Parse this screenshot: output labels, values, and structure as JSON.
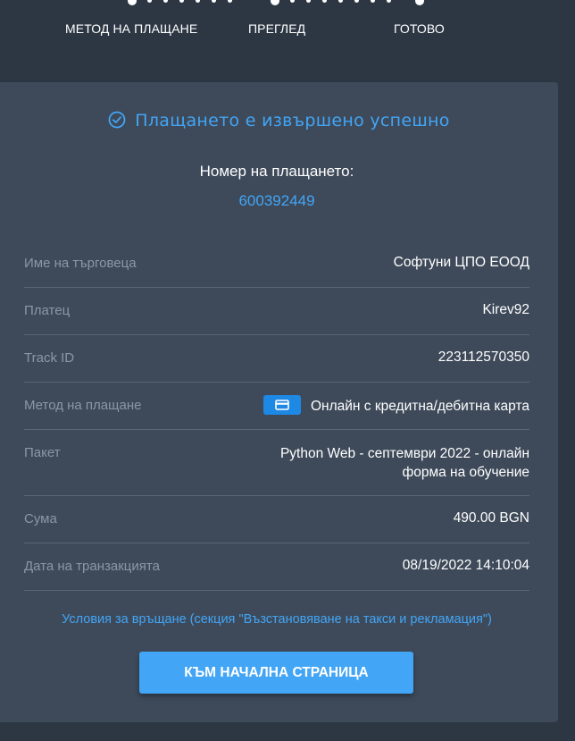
{
  "steps": [
    {
      "label": "МЕТОД НА ПЛАЩАНЕ"
    },
    {
      "label": "ПРЕГЛЕД"
    },
    {
      "label": "ГОТОВО"
    }
  ],
  "success": {
    "message": "Плащането е извършено успешно",
    "icon": "check-circle-icon",
    "color": "#42a5f5"
  },
  "payment": {
    "number_label": "Номер на плащането:",
    "number": "600392449"
  },
  "details": [
    {
      "label": "Име на търговеца",
      "value": "Софтуни ЦПО ЕООД"
    },
    {
      "label": "Платец",
      "value": "Kirev92"
    },
    {
      "label": "Track ID",
      "value": "223112570350"
    },
    {
      "label": "Метод на плащане",
      "value": "Онлайн с кредитна/дебитна карта",
      "icon": "credit-card-icon"
    },
    {
      "label": "Пакет",
      "value_line1": "Python Web - септември 2022 - онлайн",
      "value_line2": "форма на обучение"
    },
    {
      "label": "Сума",
      "value": "490.00 BGN"
    },
    {
      "label": "Дата на транзакцията",
      "value": "08/19/2022 14:10:04"
    }
  ],
  "terms_link": "Условия за връщане (секция \"Възстановяване на такси и рекламация\")",
  "home_button": "КЪМ НАЧАЛНА СТРАНИЦА",
  "colors": {
    "background": "#2d3744",
    "card": "#3e4a5a",
    "accent": "#42a5f5",
    "label": "#8c97a5"
  }
}
